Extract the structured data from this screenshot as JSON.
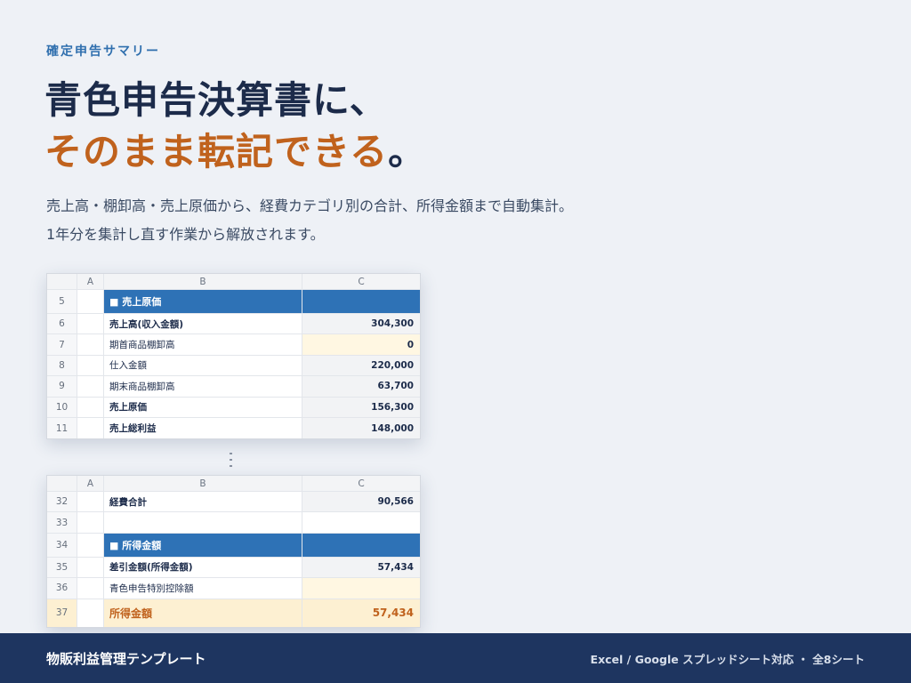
{
  "eyebrow": "確定申告サマリー",
  "headline": {
    "line1": "青色申告決算書に、",
    "line2": "そのまま転記できる",
    "line2_end": "。"
  },
  "description": {
    "line1": "売上高・棚卸高・売上原価から、経費カテゴリ別の合計、所得金額まで自動集計。",
    "line2": "1年分を集計し直す作業から解放されます。"
  },
  "sheet_top": {
    "columns": [
      "A",
      "B",
      "C"
    ],
    "section_row": {
      "num": "5",
      "label": "■ 売上原価"
    },
    "rows": [
      {
        "num": "6",
        "label": "売上高(収入金額)",
        "value": "304,300"
      },
      {
        "num": "7",
        "label": "期首商品棚卸高",
        "value": "0"
      },
      {
        "num": "8",
        "label": "仕入金額",
        "value": "220,000"
      },
      {
        "num": "9",
        "label": "期末商品棚卸高",
        "value": "63,700"
      },
      {
        "num": "10",
        "label": "売上原価",
        "value": "156,300"
      },
      {
        "num": "11",
        "label": "売上総利益",
        "value": "148,000"
      }
    ]
  },
  "sheet_bottom": {
    "columns": [
      "A",
      "B",
      "C"
    ],
    "rows_before": [
      {
        "num": "32",
        "label": "経費合計",
        "value": "90,566"
      },
      {
        "num": "33",
        "label": "",
        "value": ""
      }
    ],
    "section_row": {
      "num": "34",
      "label": "■ 所得金額"
    },
    "rows_after": [
      {
        "num": "35",
        "label": "差引金額(所得金額)",
        "value": "57,434"
      },
      {
        "num": "36",
        "label": "青色申告特別控除額",
        "value": ""
      }
    ],
    "result_row": {
      "num": "37",
      "label": "所得金額",
      "value": "57,434"
    }
  },
  "footer": {
    "brand": "物販利益管理テンプレート",
    "meta": "Excel / Google スプレッドシート対応 ・ 全8シート"
  },
  "colors": {
    "background": "#eef1f6",
    "navy": "#1c2b4a",
    "accent_orange": "#c0621d",
    "section_blue": "#2e72b6",
    "footer_bg": "#1e3560"
  }
}
